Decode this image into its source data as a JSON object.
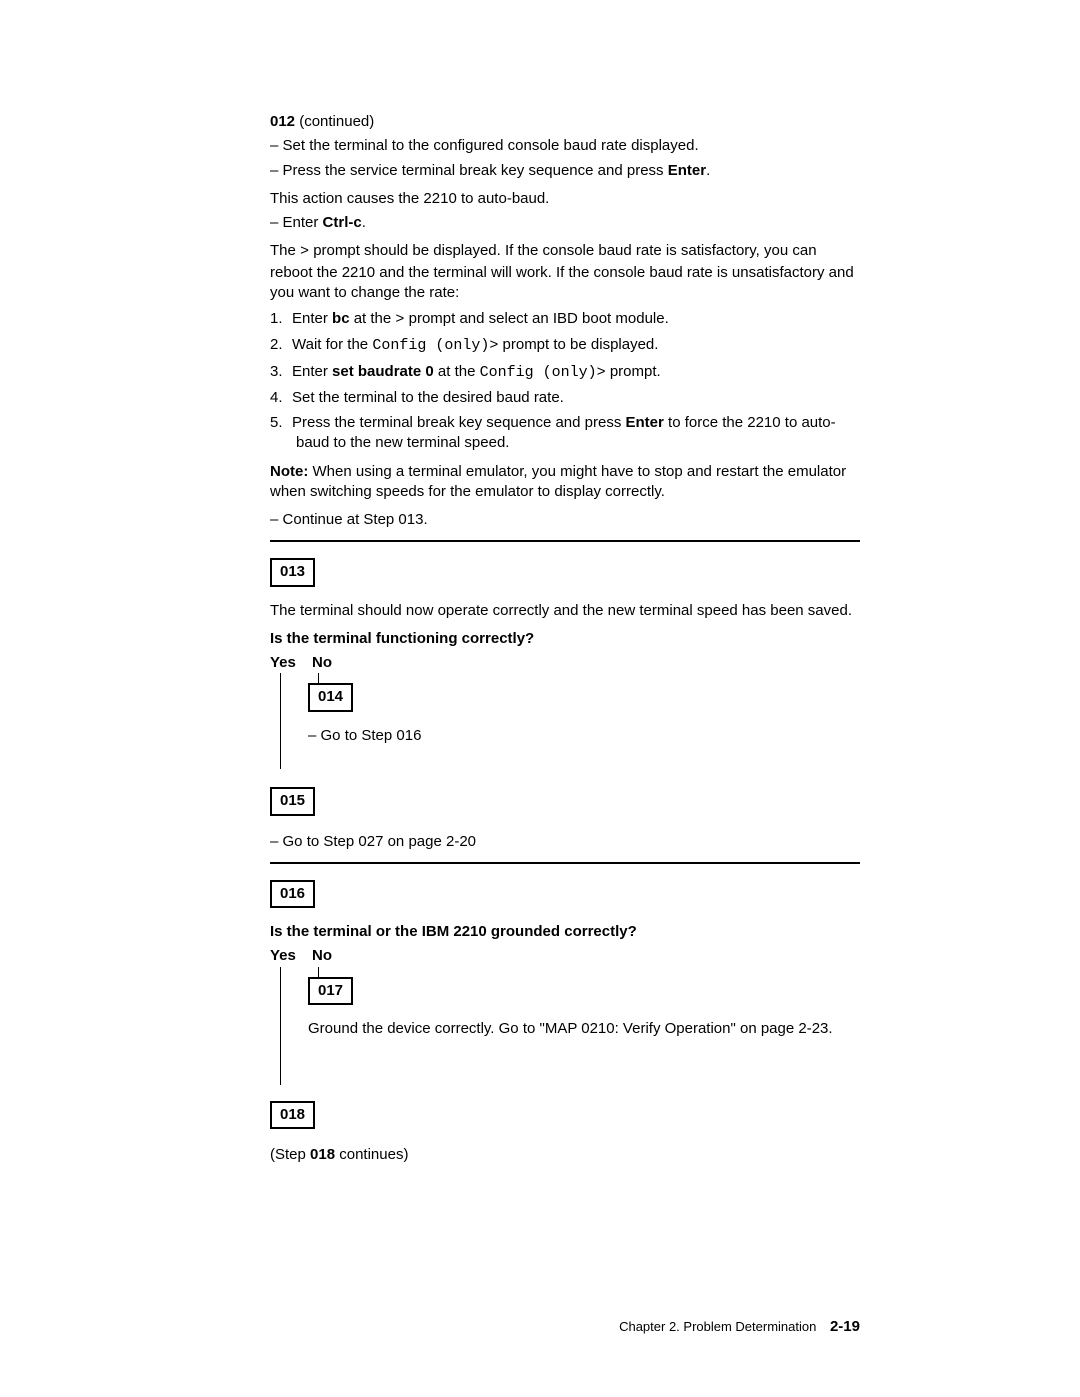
{
  "s012": {
    "head_num": "012",
    "head_cont": " (continued)",
    "d1": "Set the terminal to the configured console baud rate displayed.",
    "d2a": "Press the service terminal break key sequence and press ",
    "d2b": "Enter",
    "d2c": ".",
    "p1": "This action causes the 2210 to auto-baud.",
    "d3a": "Enter ",
    "d3b": "Ctrl-c",
    "d3c": ".",
    "p2a": "The ",
    "p2gt": ">",
    "p2b": " prompt should be displayed.  If the console baud rate is satisfactory, you can reboot the 2210 and the terminal will work.  If the console baud rate is unsatisfactory and you want to change the rate:",
    "o1n": "1.",
    "o1a": "Enter ",
    "o1b": "bc",
    "o1c": " at the ",
    "o1gt": ">",
    "o1d": " prompt and select an IBD boot module.",
    "o2n": "2.",
    "o2a": "Wait for the ",
    "o2m": "Config (only)>",
    "o2b": " prompt to be displayed.",
    "o3n": "3.",
    "o3a": "Enter ",
    "o3b": "set baudrate 0",
    "o3c": " at the ",
    "o3m": "Config (only)>",
    "o3d": " prompt.",
    "o4n": "4.",
    "o4a": "Set the terminal to the desired baud rate.",
    "o5n": "5.",
    "o5a": "Press the terminal break key sequence and press ",
    "o5b": "Enter",
    "o5c": " to force the 2210 to auto-baud to the new terminal speed.",
    "noteHead": "Note:",
    "noteBody": "  When using a terminal emulator, you might have to stop and restart the emulator when switching speeds for the emulator to display correctly.",
    "cont": "Continue at Step 013."
  },
  "s013": {
    "box": "013",
    "p": "The terminal should now operate correctly and the new terminal speed has been saved.",
    "q": "Is the terminal functioning correctly?",
    "yes": "Yes",
    "no": "No",
    "noBox": "014",
    "noBody": "Go to Step 016",
    "yesBox": "015",
    "after": "Go to Step 027 on page  2-20"
  },
  "s016": {
    "box": "016",
    "q": "Is the terminal or the IBM 2210 grounded correctly?",
    "yes": "Yes",
    "no": "No",
    "noBox": "017",
    "noBody": "Ground the device correctly.  Go to \"MAP 0210:  Verify Operation\" on page  2-23.",
    "yesBox": "018",
    "afterA": "(Step ",
    "afterB": "018",
    "afterC": " continues)"
  },
  "footer": {
    "chap": "Chapter 2.  Problem Determination",
    "page": "2-19"
  }
}
